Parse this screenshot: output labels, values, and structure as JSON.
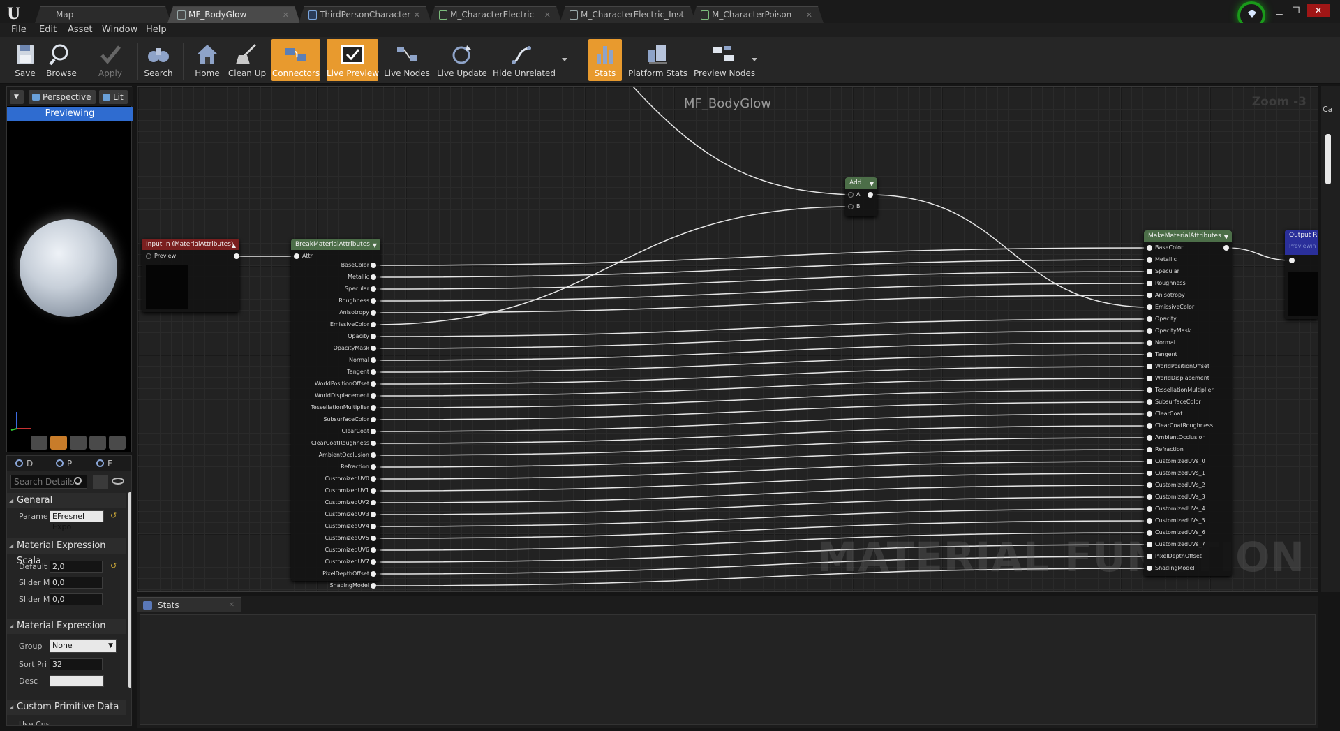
{
  "tabs": [
    {
      "label": "Map",
      "icon": "map-icon"
    },
    {
      "label": "MF_BodyGlow",
      "icon": "material-function-icon"
    },
    {
      "label": "ThirdPersonCharacter",
      "icon": "blueprint-icon"
    },
    {
      "label": "M_CharacterElectric",
      "icon": "material-icon"
    },
    {
      "label": "M_CharacterElectric_Inst",
      "icon": "material-instance-icon"
    },
    {
      "label": "M_CharacterPoison",
      "icon": "material-icon"
    }
  ],
  "menu": [
    "File",
    "Edit",
    "Asset",
    "Window",
    "Help"
  ],
  "toolbar": {
    "save": "Save",
    "browse": "Browse",
    "apply": "Apply",
    "search": "Search",
    "home": "Home",
    "cleanup": "Clean Up",
    "connectors": "Connectors",
    "live_preview": "Live Preview",
    "live_nodes": "Live Nodes",
    "live_update": "Live Update",
    "hide_unrelated": "Hide Unrelated",
    "stats": "Stats",
    "platform_stats": "Platform Stats",
    "preview_nodes": "Preview Nodes"
  },
  "viewport": {
    "perspective": "Perspective",
    "lit": "Lit",
    "previewing": "Previewing"
  },
  "details": {
    "tabs": [
      "D",
      "P",
      "F"
    ],
    "search_placeholder": "Search Details",
    "general": "General",
    "param_label": "Parame",
    "param_value": "EFresnel Expo",
    "scalar_category": "Material Expression Scala",
    "default_label": "Default",
    "default_value": "2,0",
    "slider_min_label": "Slider M",
    "slider_min_value": "0,0",
    "slider_max_label": "Slider M",
    "slider_max_value": "0,0",
    "expr_category": "Material Expression",
    "group_label": "Group",
    "group_value": "None",
    "sort_label": "Sort Pri",
    "sort_value": "32",
    "desc_label": "Desc",
    "desc_value": "",
    "custom_category": "Custom Primitive Data",
    "use_label": "Use Cus"
  },
  "graph": {
    "title": "MF_BodyGlow",
    "zoom": "Zoom -3",
    "watermark": "MATERIAL FUNCTION",
    "input_node": {
      "title": "Input In (MaterialAttributes)",
      "pin": "Preview"
    },
    "break_node": {
      "title": "BreakMaterialAttributes",
      "input": "Attr",
      "outputs": [
        "BaseColor",
        "Metallic",
        "Specular",
        "Roughness",
        "Anisotropy",
        "EmissiveColor",
        "Opacity",
        "OpacityMask",
        "Normal",
        "Tangent",
        "WorldPositionOffset",
        "WorldDisplacement",
        "TessellationMultiplier",
        "SubsurfaceColor",
        "ClearCoat",
        "ClearCoatRoughness",
        "AmbientOcclusion",
        "Refraction",
        "CustomizedUV0",
        "CustomizedUV1",
        "CustomizedUV2",
        "CustomizedUV3",
        "CustomizedUV4",
        "CustomizedUV5",
        "CustomizedUV6",
        "CustomizedUV7",
        "PixelDepthOffset",
        "ShadingModel"
      ]
    },
    "add_node": {
      "title": "Add",
      "pins": [
        "A",
        "B"
      ]
    },
    "make_node": {
      "title": "MakeMaterialAttributes",
      "inputs": [
        "BaseColor",
        "Metallic",
        "Specular",
        "Roughness",
        "Anisotropy",
        "EmissiveColor",
        "Opacity",
        "OpacityMask",
        "Normal",
        "Tangent",
        "WorldPositionOffset",
        "WorldDisplacement",
        "TessellationMultiplier",
        "SubsurfaceColor",
        "ClearCoat",
        "ClearCoatRoughness",
        "AmbientOcclusion",
        "Refraction",
        "CustomizedUVs_0",
        "CustomizedUVs_1",
        "CustomizedUVs_2",
        "CustomizedUVs_3",
        "CustomizedUVs_4",
        "CustomizedUVs_5",
        "CustomizedUVs_6",
        "CustomizedUVs_7",
        "PixelDepthOffset",
        "ShadingModel"
      ]
    },
    "output_node": {
      "title": "Output R",
      "sub": "Previewin"
    }
  },
  "stats": {
    "tab": "Stats"
  },
  "right_strip": {
    "label": "Ca"
  },
  "colors": {
    "accent_orange": "#e89a2e",
    "previewing_blue": "#2f6cd0",
    "break_header": "#4c6e48",
    "make_header": "#4c6e48",
    "add_header": "#4c6e48",
    "input_header": "#7a1f1f",
    "output_header": "#2a2f9a",
    "close_red": "#a01616"
  }
}
